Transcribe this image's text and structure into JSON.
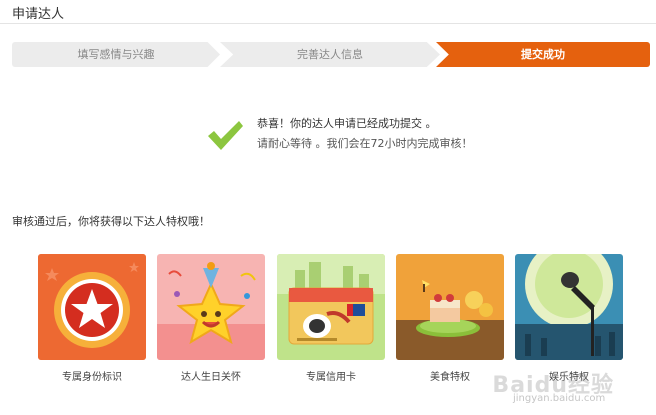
{
  "header": {
    "title": "申请达人"
  },
  "steps": [
    {
      "label": "填写感情与兴趣",
      "state": "done"
    },
    {
      "label": "完善达人信息",
      "state": "done"
    },
    {
      "label": "提交成功",
      "state": "active"
    }
  ],
  "success": {
    "icon": "check-icon",
    "line1": "恭喜！你的达人申请已经成功提交 。",
    "line2": "请耐心等待 。我们会在72小时内完成审核！"
  },
  "perks_title": "审核通过后，你将获得以下达人特权哦！",
  "perks": [
    {
      "label": "专属身份标识",
      "icon": "star-badge-icon"
    },
    {
      "label": "达人生日关怀",
      "icon": "birthday-star-icon"
    },
    {
      "label": "专属信用卡",
      "icon": "credit-card-icon"
    },
    {
      "label": "美食特权",
      "icon": "food-cake-icon"
    },
    {
      "label": "娱乐特权",
      "icon": "microphone-icon"
    }
  ],
  "watermark": {
    "text": "Baidu经验",
    "url": "jingyan.baidu.com"
  },
  "colors": {
    "accent": "#e5610e",
    "check": "#8cc63f"
  }
}
